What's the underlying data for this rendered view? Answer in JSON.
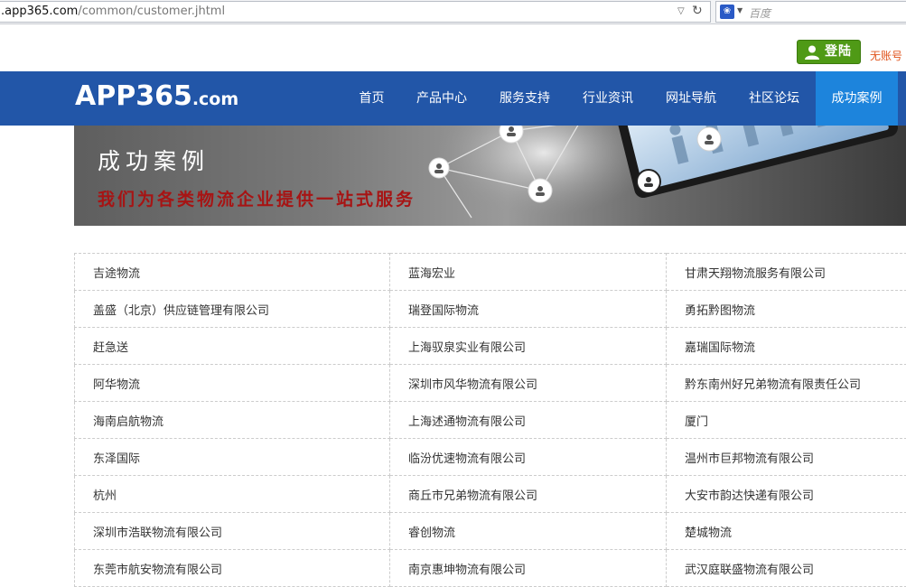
{
  "browser": {
    "url_host": ".app365.com",
    "url_path": "/common/customer.jhtml",
    "search_placeholder": "百度"
  },
  "header": {
    "login_label": "登陆",
    "register_link": "无账号"
  },
  "nav": {
    "logo_main": "APP365",
    "logo_suffix": ".com",
    "items": [
      {
        "label": "首页"
      },
      {
        "label": "产品中心"
      },
      {
        "label": "服务支持"
      },
      {
        "label": "行业资讯"
      },
      {
        "label": "网址导航"
      },
      {
        "label": "社区论坛"
      },
      {
        "label": "成功案例",
        "active": true
      }
    ]
  },
  "banner": {
    "title": "成功案例",
    "subtitle": "我们为各类物流企业提供一站式服务"
  },
  "customers": [
    [
      "吉途物流",
      "蓝海宏业",
      "甘肃天翔物流服务有限公司"
    ],
    [
      "盖盛（北京）供应链管理有限公司",
      "瑞登国际物流",
      "勇拓黔图物流"
    ],
    [
      "赶急送",
      "上海驭泉实业有限公司",
      "嘉瑞国际物流"
    ],
    [
      "阿华物流",
      "深圳市风华物流有限公司",
      "黔东南州好兄弟物流有限责任公司"
    ],
    [
      "海南启航物流",
      "上海述通物流有限公司",
      "厦门"
    ],
    [
      "东泽国际",
      "临汾优速物流有限公司",
      "温州市巨邦物流有限公司"
    ],
    [
      "杭州",
      "商丘市兄弟物流有限公司",
      "大安市韵达快递有限公司"
    ],
    [
      "深圳市浩联物流有限公司",
      "睿创物流",
      "楚城物流"
    ],
    [
      "东莞市航安物流有限公司",
      "南京惠坤物流有限公司",
      "武汉庭联盛物流有限公司"
    ]
  ],
  "colors": {
    "nav_bg": "#2256a8",
    "nav_active": "#1d84dc",
    "login_green": "#4f9a16",
    "register_orange": "#e0541c",
    "banner_subtitle": "#a71414"
  }
}
